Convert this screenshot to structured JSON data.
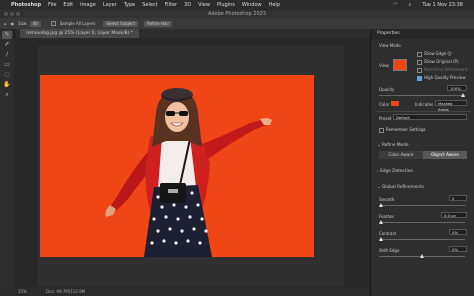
{
  "menubar": {
    "app": "Photoshop",
    "items": [
      "File",
      "Edit",
      "Image",
      "Layer",
      "Type",
      "Select",
      "Filter",
      "3D",
      "View",
      "Plugins",
      "Window",
      "Help"
    ],
    "clock": "Tue 1 Nov 23:38"
  },
  "window": {
    "title": "Adobe Photoshop 2023"
  },
  "options": {
    "size_label": "Size:",
    "size_value": "40",
    "sample_all_layers": "Sample All Layers",
    "select_subject": "Select Subject",
    "refine_hair": "Refine Hair"
  },
  "document": {
    "tab": "removebg.jpg @ 25% (Layer 0, Layer Mask/8) *"
  },
  "status": {
    "zoom": "25%",
    "doc": "Doc: 99.7M/112.9M"
  },
  "panel": {
    "title": "Properties",
    "view_mode": "View Mode",
    "view": "View:",
    "show_edge": "Show Edge (J)",
    "show_original": "Show Original (P)",
    "realtime": "Real-time Refinement",
    "hq_preview": "High Quality Preview",
    "opacity_label": "Opacity",
    "opacity_value": "100%",
    "color_label": "Color",
    "indicates_label": "Indicates",
    "indicates_value": "Masked Areas",
    "preset_label": "Preset",
    "preset_value": "Default",
    "remember": "Remember Settings",
    "refine_mode": "Refine Mode",
    "color_aware": "Color Aware",
    "object_aware": "Object Aware",
    "edge_detection": "Edge Detection",
    "global_refinements": "Global Refinements",
    "smooth_label": "Smooth",
    "smooth_value": "0",
    "feather_label": "Feather",
    "feather_value": "0.0 px",
    "contrast_label": "Contrast",
    "contrast_value": "0%",
    "shift_edge_label": "Shift Edge",
    "shift_edge_value": "0%",
    "opacity_level": 1.0,
    "smooth_level": 0.0,
    "feather_level": 0.0,
    "contrast_level": 0.0,
    "shift_edge_level": 0.5
  },
  "colors": {
    "background": "#f04515",
    "accent": "#6a9fd8"
  }
}
